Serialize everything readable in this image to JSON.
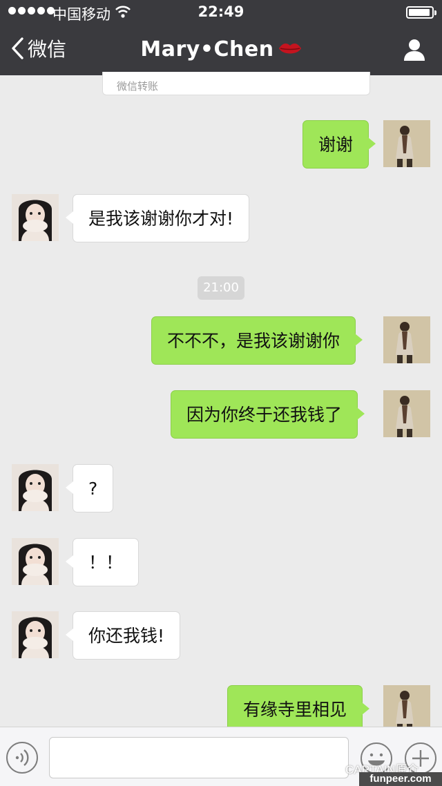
{
  "status_bar": {
    "carrier": "中国移动",
    "time": "22:49"
  },
  "nav": {
    "back_label": "微信",
    "title": "Mary•Chen"
  },
  "transfer_card": {
    "label": "微信转账"
  },
  "messages": [
    {
      "side": "out",
      "text": "谢谢"
    },
    {
      "side": "in",
      "text": "是我该谢谢你才对!"
    },
    {
      "side": "out",
      "text": "不不不，是我该谢谢你"
    },
    {
      "side": "out",
      "text": "因为你终于还我钱了"
    },
    {
      "side": "in",
      "text": "?"
    },
    {
      "side": "in",
      "text": "！！"
    },
    {
      "side": "in",
      "text": "你还我钱!"
    },
    {
      "side": "out",
      "text": "有缘寺里相见"
    }
  ],
  "timestamp": "21:00",
  "watermark": {
    "account": "CAPTAIN原介",
    "site": "funpeer.com"
  },
  "colors": {
    "nav_bg": "#3a3a3e",
    "chat_bg": "#ebebeb",
    "outgoing_bubble": "#9fe658",
    "incoming_bubble": "#ffffff"
  },
  "icons": [
    "back-chevron-icon",
    "lips-icon",
    "profile-icon",
    "voice-icon",
    "emoji-icon",
    "plus-icon",
    "wifi-icon",
    "battery-icon"
  ]
}
